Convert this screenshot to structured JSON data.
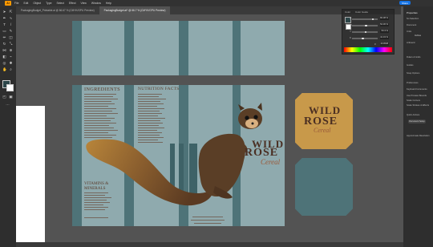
{
  "app": {
    "logo": "Ai",
    "share_label": "Share"
  },
  "menu": [
    "File",
    "Edit",
    "Object",
    "Type",
    "Select",
    "Effect",
    "View",
    "Window",
    "Help"
  ],
  "tabs": [
    {
      "label": "PackagingBudget_Printable.ai @ 66.67 % (CMYK/GPU Preview)",
      "active": false
    },
    {
      "label": "PackagingBudget.ai* @ 66.7 % (CMYK/GPU Preview)",
      "active": true
    }
  ],
  "package": {
    "ingredients_title": "INGREDIENTS",
    "nutrition_title": "NUTRITION FACTS",
    "vitamins_title": "VITAMINS & MINERALS",
    "brand_line1": "WILD",
    "brand_line2": "ROSE",
    "cereal": "Cereal",
    "badge_line1": "WILD",
    "badge_line2": "ROSE",
    "badge_cereal": "Cereal"
  },
  "colors": {
    "fill": "#2c4548",
    "artboard": "#8faaae",
    "stripe": "#4e7378",
    "badge_gold": "#c8994a",
    "badge_teal": "#4e7378"
  },
  "properties": {
    "title": "Properties",
    "items": [
      "No Selection",
      "Document",
      "Units",
      "Artboard",
      "Rulers & Grids",
      "Guides",
      "Snap Options",
      "Preferences",
      "Keyboard Increments",
      "Use Preview Bounds",
      "Scale Corners",
      "Scale Strokes & Effects",
      "Quick Actions",
      "Document Setup",
      "Approximate Resolution"
    ],
    "document_setup_button": "Document Setup",
    "units_value": "Inches"
  },
  "color_panel": {
    "tab1": "Color",
    "tab2": "Color Guide",
    "rows": [
      {
        "label": "C",
        "value": "82.38 %",
        "pos": 0.82
      },
      {
        "label": "M",
        "value": "54.36 %",
        "pos": 0.54
      },
      {
        "label": "Y",
        "value": "53.3 %",
        "pos": 0.53
      },
      {
        "label": "K",
        "value": "41.19 %",
        "pos": 0.41
      }
    ],
    "hex_label": "#",
    "hex": "2C4548"
  }
}
